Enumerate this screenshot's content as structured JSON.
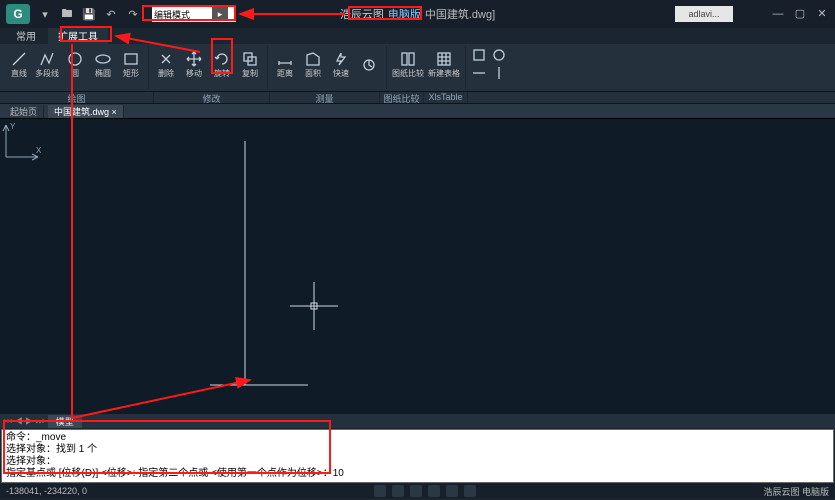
{
  "title": {
    "brand": "浩辰云图",
    "edition": "电脑版",
    "doc": "中国建筑.dwg]"
  },
  "user": "adlavi...",
  "search": {
    "value": "编辑模式"
  },
  "tabs": {
    "t1": "常用",
    "t2": "扩展工具"
  },
  "ribbon": {
    "g1": {
      "b1": "直线",
      "b2": "多段线",
      "b3": "圆",
      "b4": "椭圆",
      "b5": "矩形",
      "lbl": "绘图"
    },
    "g2": {
      "b1": "删除",
      "b2": "移动",
      "b3": "旋转",
      "b4": "复制",
      "lbl": "修改"
    },
    "g3": {
      "b1": "距离",
      "b2": "面积",
      "b3": "快速",
      "lbl": "测量"
    },
    "g4": {
      "b1": "图纸比较",
      "b2": "新建表格",
      "lbl1": "图纸比较",
      "lbl2": "XlsTable"
    }
  },
  "doctabs": {
    "t1": "起始页",
    "t2": "中国建筑.dwg",
    "x": "×"
  },
  "modeltabs": {
    "m": "模型"
  },
  "cmd": {
    "l1": "命令：_move",
    "l2": "选择对象：找到 1 个",
    "l3": "选择对象：",
    "l4": "指定基点或 [位移(D)] <位移>:   指定第二个点或 <使用第一个点作为位移>：10"
  },
  "status": {
    "coords": "-138041, -234220, 0",
    "right": "浩辰云图 电脑版"
  }
}
